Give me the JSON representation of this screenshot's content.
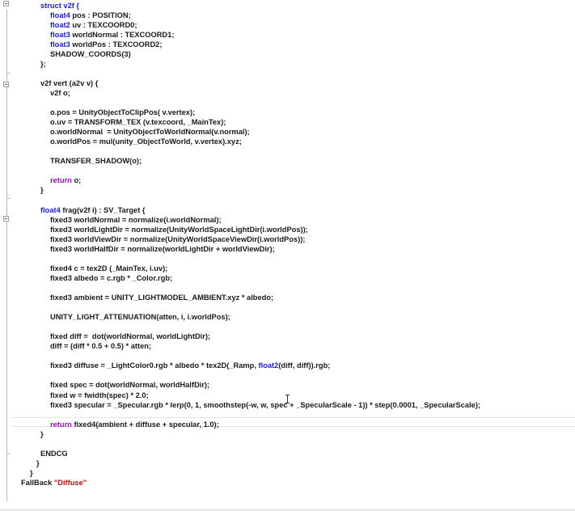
{
  "editor": {
    "language": "ShaderLab / CG",
    "colors": {
      "keyword": "#1d1cc4",
      "return_keyword": "#8a16a8",
      "string": "#a31515",
      "text": "#1a1a1a"
    },
    "lines": [
      {
        "indent": 1,
        "parts": [
          {
            "t": "struct v2f {",
            "c": "kw"
          }
        ]
      },
      {
        "indent": 2,
        "parts": [
          {
            "t": "float4",
            "c": "kw"
          },
          {
            "t": " pos : POSITION;"
          }
        ]
      },
      {
        "indent": 2,
        "parts": [
          {
            "t": "float2",
            "c": "kw"
          },
          {
            "t": " uv : TEXCOORD0;"
          }
        ]
      },
      {
        "indent": 2,
        "parts": [
          {
            "t": "float3",
            "c": "kw"
          },
          {
            "t": " worldNormal : TEXCOORD1;"
          }
        ]
      },
      {
        "indent": 2,
        "parts": [
          {
            "t": "float3",
            "c": "kw"
          },
          {
            "t": " worldPos : TEXCOORD2;"
          }
        ]
      },
      {
        "indent": 2,
        "parts": [
          {
            "t": "SHADOW_COORDS(3)"
          }
        ]
      },
      {
        "indent": 1,
        "parts": [
          {
            "t": "};"
          }
        ]
      },
      {
        "indent": 0,
        "parts": []
      },
      {
        "indent": 1,
        "parts": [
          {
            "t": "v2f vert (a2v v) {"
          }
        ]
      },
      {
        "indent": 2,
        "parts": [
          {
            "t": "v2f o;"
          }
        ]
      },
      {
        "indent": 0,
        "parts": []
      },
      {
        "indent": 2,
        "parts": [
          {
            "t": "o.pos = UnityObjectToClipPos( v.vertex);"
          }
        ]
      },
      {
        "indent": 2,
        "parts": [
          {
            "t": "o.uv = TRANSFORM_TEX (v.texcoord, _MainTex);"
          }
        ]
      },
      {
        "indent": 2,
        "parts": [
          {
            "t": "o.worldNormal  = UnityObjectToWorldNormal(v.normal);"
          }
        ]
      },
      {
        "indent": 2,
        "parts": [
          {
            "t": "o.worldPos = mul(unity_ObjectToWorld, v.vertex).xyz;"
          }
        ]
      },
      {
        "indent": 0,
        "parts": []
      },
      {
        "indent": 2,
        "parts": [
          {
            "t": "TRANSFER_SHADOW(o);"
          }
        ]
      },
      {
        "indent": 0,
        "parts": []
      },
      {
        "indent": 2,
        "parts": [
          {
            "t": "return",
            "c": "ret"
          },
          {
            "t": " o;"
          }
        ]
      },
      {
        "indent": 1,
        "parts": [
          {
            "t": "}"
          }
        ]
      },
      {
        "indent": 0,
        "parts": []
      },
      {
        "indent": 1,
        "parts": [
          {
            "t": "float4",
            "c": "kw"
          },
          {
            "t": " frag(v2f i) : SV_Target {"
          }
        ]
      },
      {
        "indent": 2,
        "parts": [
          {
            "t": "fixed3 worldNormal = normalize(i.worldNormal);"
          }
        ]
      },
      {
        "indent": 2,
        "parts": [
          {
            "t": "fixed3 worldLightDir = normalize(UnityWorldSpaceLightDir(i.worldPos));"
          }
        ]
      },
      {
        "indent": 2,
        "parts": [
          {
            "t": "fixed3 worldViewDir = normalize(UnityWorldSpaceViewDir(i.worldPos));"
          }
        ]
      },
      {
        "indent": 2,
        "parts": [
          {
            "t": "fixed3 worldHalfDir = normalize(worldLightDir + worldViewDir);"
          }
        ]
      },
      {
        "indent": 0,
        "parts": []
      },
      {
        "indent": 2,
        "parts": [
          {
            "t": "fixed4 c = tex2D (_MainTex, i.uv);"
          }
        ]
      },
      {
        "indent": 2,
        "parts": [
          {
            "t": "fixed3 albedo = c.rgb * _Color.rgb;"
          }
        ]
      },
      {
        "indent": 0,
        "parts": []
      },
      {
        "indent": 2,
        "parts": [
          {
            "t": "fixed3 ambient = UNITY_LIGHTMODEL_AMBIENT.xyz * albedo;"
          }
        ]
      },
      {
        "indent": 0,
        "parts": []
      },
      {
        "indent": 2,
        "parts": [
          {
            "t": "UNITY_LIGHT_ATTENUATION(atten, i, i.worldPos);"
          }
        ]
      },
      {
        "indent": 0,
        "parts": []
      },
      {
        "indent": 2,
        "parts": [
          {
            "t": "fixed diff =  dot(worldNormal, worldLightDir);"
          }
        ]
      },
      {
        "indent": 2,
        "parts": [
          {
            "t": "diff = (diff * 0.5 + 0.5) * atten;"
          }
        ]
      },
      {
        "indent": 0,
        "parts": []
      },
      {
        "indent": 2,
        "parts": [
          {
            "t": "fixed3 diffuse = _LightColor0.rgb * albedo * tex2D(_Ramp, "
          },
          {
            "t": "float2",
            "c": "kw"
          },
          {
            "t": "(diff, diff)).rgb;"
          }
        ]
      },
      {
        "indent": 0,
        "parts": []
      },
      {
        "indent": 2,
        "parts": [
          {
            "t": "fixed spec = dot(worldNormal, worldHalfDir);"
          }
        ]
      },
      {
        "indent": 2,
        "parts": [
          {
            "t": "fixed w = fwidth(spec) * 2.0;"
          }
        ]
      },
      {
        "indent": 2,
        "parts": [
          {
            "t": "fixed3 specular = _Specular.rgb * lerp(0, 1, smoothstep(-w, w, spec + _SpecularScale - 1)) * step(0.0001, _SpecularScale);"
          }
        ]
      },
      {
        "indent": 0,
        "parts": []
      },
      {
        "indent": 2,
        "parts": [
          {
            "t": "return",
            "c": "ret"
          },
          {
            "t": " fixed4(ambient + diffuse + specular, 1.0);"
          }
        ]
      },
      {
        "indent": 1,
        "parts": [
          {
            "t": "}"
          }
        ]
      },
      {
        "indent": 0,
        "parts": []
      },
      {
        "indent": 1,
        "parts": [
          {
            "t": "ENDCG"
          }
        ]
      },
      {
        "indent": -1,
        "parts": [
          {
            "t": "}"
          }
        ]
      },
      {
        "indent": -2,
        "parts": [
          {
            "t": "}"
          }
        ]
      },
      {
        "indent": -3,
        "parts": [
          {
            "t": "FallBack "
          },
          {
            "t": "\"Diffuse\"",
            "c": "str"
          }
        ]
      }
    ]
  },
  "gutter": {
    "fold_markers": [
      "collapse-icon",
      "collapse-icon",
      "collapse-icon"
    ]
  },
  "cursor": {
    "icon": "i-beam-cursor-icon"
  }
}
